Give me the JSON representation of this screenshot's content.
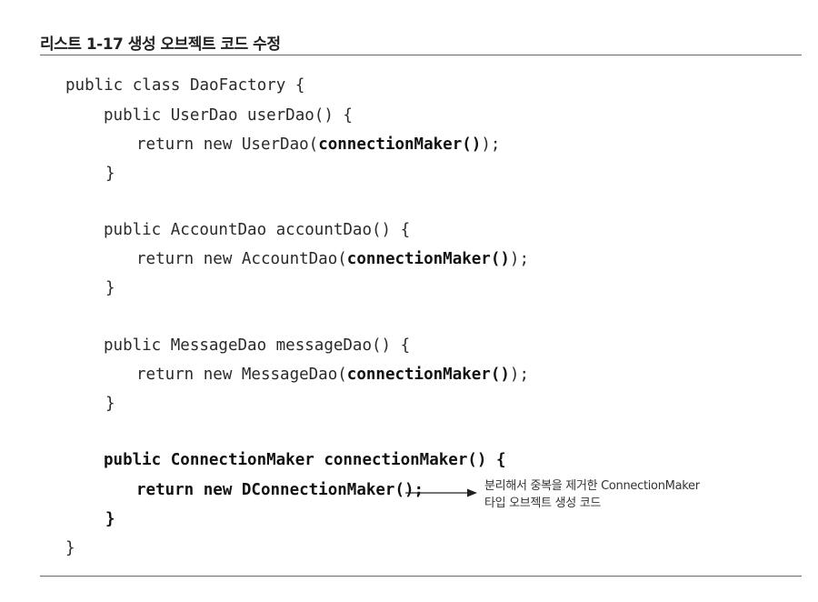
{
  "caption": "리스트 1-17 생성 오브젝트 코드 수정",
  "code": {
    "l1": "public class DaoFactory {",
    "l2": "public UserDao userDao() {",
    "l3_pre": "return new UserDao(",
    "l3_bold": "connectionMaker()",
    "l3_post": ");",
    "l4": "}",
    "l5": "public AccountDao accountDao() {",
    "l6_pre": "return new AccountDao(",
    "l6_bold": "connectionMaker()",
    "l6_post": ");",
    "l7": "}",
    "l8": "public MessageDao messageDao() {",
    "l9_pre": "return new MessageDao(",
    "l9_bold": "connectionMaker()",
    "l9_post": ");",
    "l10": "}",
    "l11": "public ConnectionMaker connectionMaker() {",
    "l12": "return new DConnectionMaker();",
    "l13": "}",
    "l14": "}"
  },
  "annotation": {
    "line1": "분리해서 중복을 제거한 ConnectionMaker",
    "line2": "타입 오브젝트 생성 코드"
  }
}
